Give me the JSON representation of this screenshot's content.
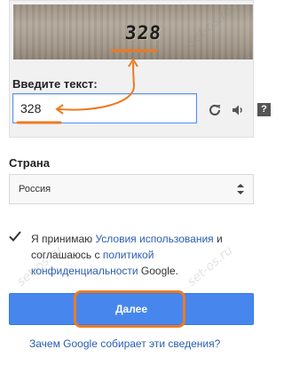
{
  "captcha": {
    "image_text": "328",
    "label": "Введите текст:",
    "input_value": "328",
    "help_glyph": "?"
  },
  "country": {
    "label": "Страна",
    "selected": "Россия"
  },
  "terms": {
    "prefix": "Я принимаю ",
    "terms_link": "Условия использования",
    "middle": " и соглашаюсь с ",
    "privacy_link": "политикой конфиденциальности",
    "suffix": " Google.",
    "checked": true
  },
  "next_button": {
    "label": "Далее"
  },
  "why_link": "Зачем Google собирает эти сведения?",
  "watermark": "set-os.ru",
  "icons": [
    "refresh-icon",
    "speaker-icon",
    "help-icon",
    "checkmark-icon",
    "select-arrows-icon"
  ],
  "colors": {
    "accent_button": "#4787ed",
    "link": "#2a5db0",
    "annotation": "#ed7a22",
    "input_focus_border": "#4d90fe"
  }
}
